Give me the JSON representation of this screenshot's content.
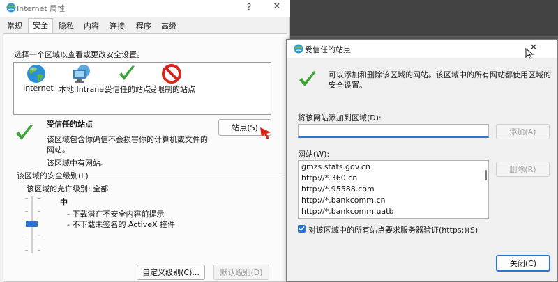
{
  "internet_properties": {
    "title": "Internet 属性",
    "help_glyph": "?",
    "close_glyph": "✕",
    "tabs": [
      {
        "label": "常规",
        "active": false
      },
      {
        "label": "安全",
        "active": true
      },
      {
        "label": "隐私",
        "active": false
      },
      {
        "label": "内容",
        "active": false
      },
      {
        "label": "连接",
        "active": false
      },
      {
        "label": "程序",
        "active": false
      },
      {
        "label": "高级",
        "active": false
      }
    ],
    "zone_prompt": "选择一个区域以查看或更改安全设置。",
    "zones": [
      {
        "label": "Internet",
        "icon": "globe-icon"
      },
      {
        "label": "本地 Intranet",
        "icon": "network-computer-icon"
      },
      {
        "label": "受信任的站点",
        "icon": "green-check-icon"
      },
      {
        "label": "受限制的站点",
        "icon": "no-entry-icon"
      }
    ],
    "selected_zone": {
      "name": "受信任的站点",
      "description": "该区域包含你确信不会损害你的计算机或文件的网站。",
      "note": "该区域中有网站。",
      "sites_button": "站点(S)"
    },
    "security_level": {
      "group_label": "该区域的安全级别(L)",
      "allowed_levels": "该区域的允许级别: 全部",
      "level_name": "中",
      "descriptions": [
        "- 下载潜在不安全内容前提示",
        "- 不下载未签名的 ActiveX 控件"
      ]
    },
    "buttons": {
      "custom": "自定义级别(C)...",
      "default": "默认级别(D)"
    }
  },
  "trusted_sites": {
    "title": "受信任的站点",
    "close_glyph": "✕",
    "info": "可以添加和删除该区域的网站。该区域中的所有网站都使用区域的安全设置。",
    "add_label": "将该网站添加到区域(D):",
    "add_value": "",
    "add_button": "添加(A)",
    "sites_label": "网站(W):",
    "sites": [
      "gmzs.stats.gov.cn",
      "http://*.360.cn",
      "http://*.95588.com",
      "http://*.bankcomm.cn",
      "http://*.bankcomm.uatb"
    ],
    "remove_button": "删除(R)",
    "require_https_label": "对该区域中的所有站点要求服务器验证(https:)(S)",
    "require_https_checked": true,
    "close_button": "关闭(C)"
  },
  "colors": {
    "accent": "#2a74d3",
    "check_green": "#3aa637",
    "restricted_red": "#d9261c"
  }
}
